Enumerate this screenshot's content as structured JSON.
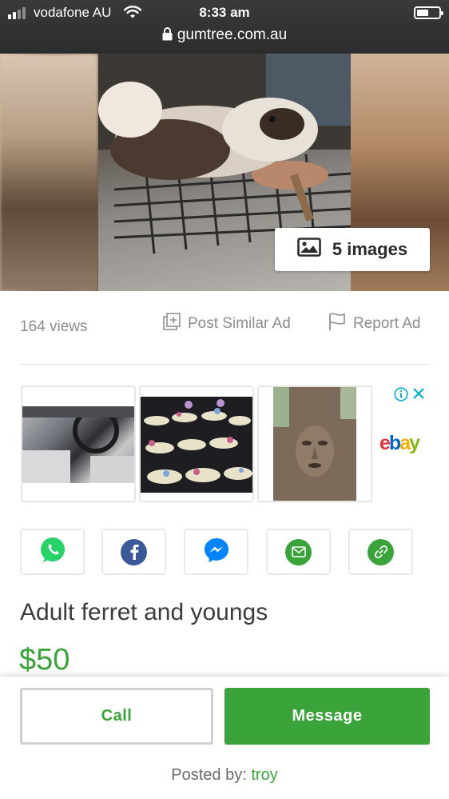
{
  "status_bar": {
    "carrier": "vodafone AU",
    "time": "8:33 am",
    "icons": [
      "signal-icon",
      "wifi-icon",
      "battery-icon"
    ]
  },
  "browser": {
    "url": "gumtree.com.au",
    "icon": "lock-icon"
  },
  "gallery": {
    "images_label": "5 images",
    "icon": "image-icon"
  },
  "ad_meta": {
    "views": "164 views",
    "post_similar": "Post Similar Ad",
    "report": "Report Ad"
  },
  "ad_banner": {
    "brand": "ebay",
    "brand_colors": [
      "#e53238",
      "#0064d2",
      "#f5af02",
      "#86b817"
    ],
    "icons": [
      "info-icon",
      "close-icon"
    ]
  },
  "share": [
    {
      "name": "whatsapp",
      "color": "#25d366"
    },
    {
      "name": "facebook",
      "color": "#3b5998"
    },
    {
      "name": "messenger",
      "color": "#0084ff"
    },
    {
      "name": "email",
      "color": "#3aa33a"
    },
    {
      "name": "link",
      "color": "#3aa33a"
    }
  ],
  "listing": {
    "title": "Adult ferret and youngs",
    "price": "$50"
  },
  "footer": {
    "call": "Call",
    "message": "Message",
    "posted_by_label": "Posted by:",
    "poster": "troy"
  },
  "colors": {
    "accent": "#3aa33a",
    "muted": "#8c8c8c"
  }
}
